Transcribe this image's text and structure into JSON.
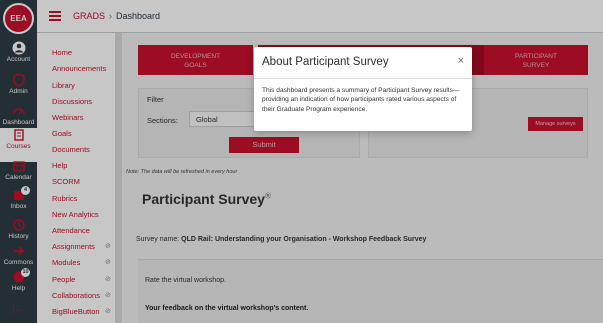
{
  "logo": {
    "text": "EEA"
  },
  "global_nav": [
    {
      "label": "Account",
      "icon": "account-icon"
    },
    {
      "label": "Admin",
      "icon": "admin-icon"
    },
    {
      "label": "Dashboard",
      "icon": "dashboard-icon"
    },
    {
      "label": "Courses",
      "icon": "courses-icon",
      "active": true
    },
    {
      "label": "Calendar",
      "icon": "calendar-icon"
    },
    {
      "label": "Inbox",
      "icon": "inbox-icon",
      "badge": "4"
    },
    {
      "label": "History",
      "icon": "history-icon"
    },
    {
      "label": "Commons",
      "icon": "commons-icon"
    },
    {
      "label": "Help",
      "icon": "help-icon",
      "badge": "10"
    }
  ],
  "header": {
    "course": "GRADS",
    "separator": "›",
    "current": "Dashboard"
  },
  "course_nav": [
    {
      "label": "Home"
    },
    {
      "label": "Announcements"
    },
    {
      "label": "Library"
    },
    {
      "label": "Discussions"
    },
    {
      "label": "Webinars"
    },
    {
      "label": "Goals"
    },
    {
      "label": "Documents"
    },
    {
      "label": "Help"
    },
    {
      "label": "SCORM"
    },
    {
      "label": "Rubrics"
    },
    {
      "label": "New Analytics"
    },
    {
      "label": "Attendance"
    },
    {
      "label": "Assignments",
      "hidden_icon": true
    },
    {
      "label": "Modules",
      "hidden_icon": true
    },
    {
      "label": "People",
      "hidden_icon": true
    },
    {
      "label": "Collaborations",
      "hidden_icon": true
    },
    {
      "label": "BigBlueButton",
      "hidden_icon": true
    }
  ],
  "tiles": [
    {
      "line1": "DEVELOPMENT",
      "line2": "GOALS"
    },
    {
      "line1": "PARTICIPANT",
      "line2": "SURVEY"
    }
  ],
  "filter": {
    "title": "Filter",
    "sections_label": "Sections:",
    "sections_value": "Global",
    "submit_label": "Submit"
  },
  "manage_surveys_label": "Manage surveys",
  "note": "Note: The data will be refreshed in every hour",
  "page_title": "Participant Survey",
  "page_title_mark": "®",
  "survey": {
    "label": "Survey name:",
    "name": "QLD Rail: Understanding your Organisation - Workshop Feedback Survey"
  },
  "questions": [
    "Rate the virtual workshop.",
    "Your feedback on the virtual workshop's content."
  ],
  "modal": {
    "title": "About Participant Survey",
    "close": "×",
    "body": "This dashboard presents a summary of Participant Survey results—providing an indication of how participants rated various aspects of their Graduate Program experience."
  },
  "colors": {
    "brand": "#c8102e",
    "nav_bg": "#2d3b45"
  }
}
